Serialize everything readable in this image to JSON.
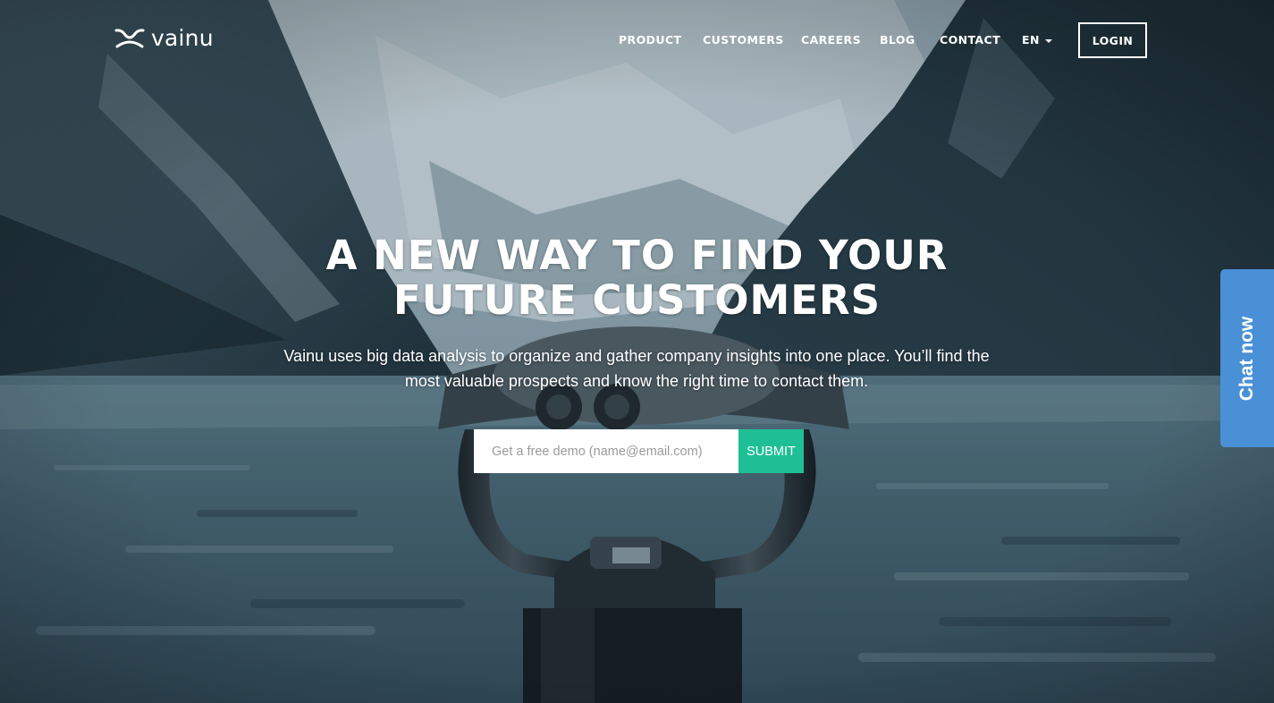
{
  "brand": {
    "name": "vainu"
  },
  "nav": {
    "items": [
      {
        "label": "PRODUCT"
      },
      {
        "label": "CUSTOMERS"
      },
      {
        "label": "CAREERS"
      },
      {
        "label": "BLOG"
      },
      {
        "label": "CONTACT"
      }
    ],
    "language": "EN",
    "login_label": "LOGIN"
  },
  "hero": {
    "title_line1": "A NEW WAY TO FIND YOUR",
    "title_line2": "FUTURE CUSTOMERS",
    "subtitle": "Vainu uses big data analysis to organize and gather company insights into one place. You’ll find the most valuable prospects and know the right time to contact them.",
    "input_placeholder": "Get a free demo (name@email.com)",
    "submit_label": "SUBMIT"
  },
  "chat": {
    "label": "Chat now"
  },
  "colors": {
    "submit_accent": "#1fbf95",
    "chat_tab": "#4a90d6"
  }
}
